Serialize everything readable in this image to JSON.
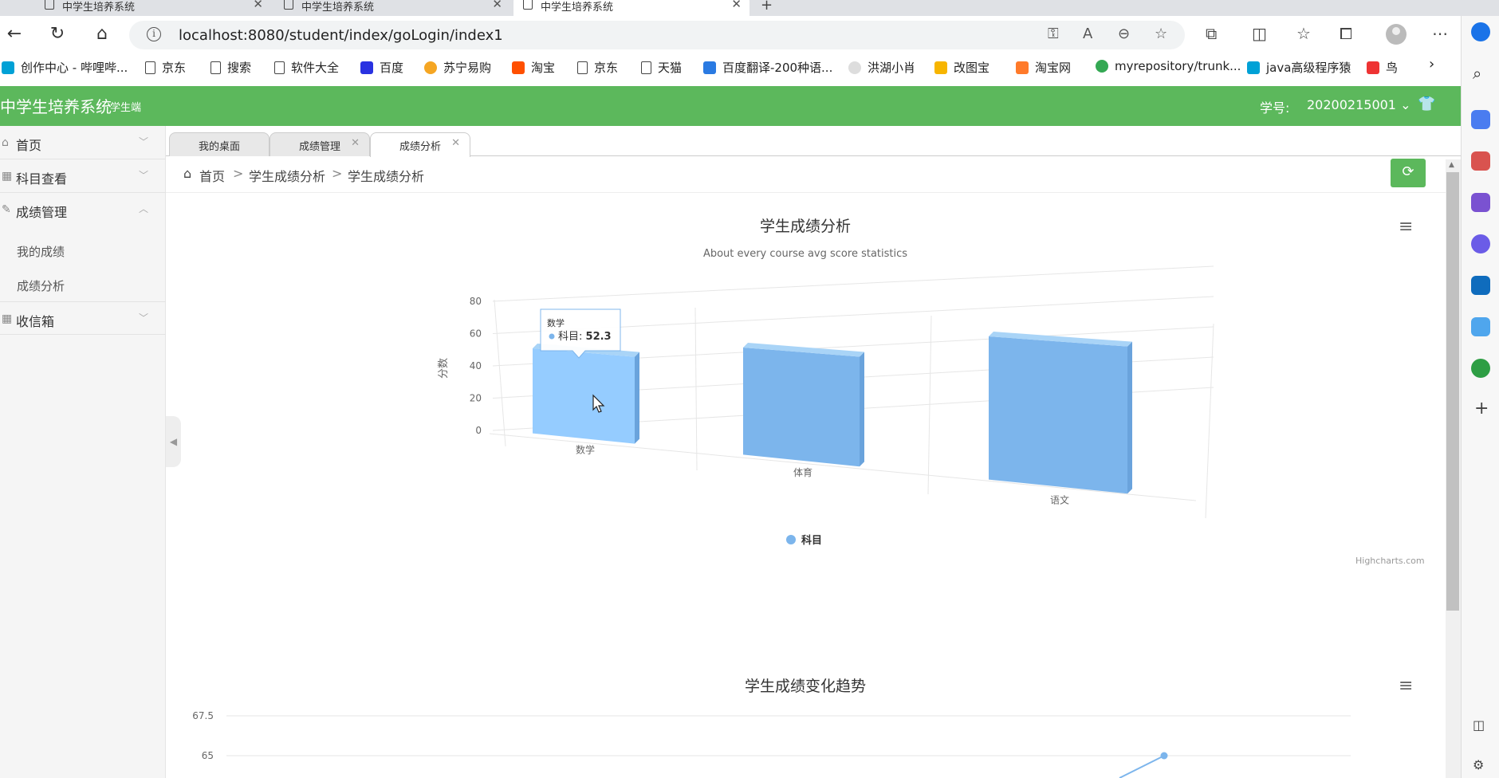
{
  "browser": {
    "tabs": [
      {
        "label": "中学生培养系统",
        "active": false
      },
      {
        "label": "中学生培养系统",
        "active": false
      },
      {
        "label": "中学生培养系统",
        "active": true
      }
    ],
    "url": "localhost:8080/student/index/goLogin/index1",
    "bookmarks": [
      "创作中心 - 哔哩哔...",
      "京东",
      "搜索",
      "软件大全",
      "百度",
      "苏宁易购",
      "淘宝",
      "京东",
      "天猫",
      "百度翻译-200种语...",
      "洪湖小肖",
      "改图宝",
      "淘宝网",
      "myrepository/trunk...",
      "java高级程序猿",
      "鸟"
    ]
  },
  "header": {
    "title": "中学生培养系统",
    "subtitle": "学生端",
    "student_label": "学号:",
    "student_id": "20200215001"
  },
  "sidebar": {
    "items": [
      {
        "label": "首页"
      },
      {
        "label": "科目查看"
      },
      {
        "label": "成绩管理"
      },
      {
        "label": "收信箱"
      }
    ],
    "subitems": [
      "我的成绩",
      "成绩分析"
    ]
  },
  "content_tabs": [
    {
      "label": "我的桌面",
      "closable": false
    },
    {
      "label": "成绩管理",
      "closable": true
    },
    {
      "label": "成绩分析",
      "closable": true,
      "active": true
    }
  ],
  "breadcrumb": [
    "首页",
    "学生成绩分析",
    "学生成绩分析"
  ],
  "breadcrumb_sep": ">",
  "chart_data": [
    {
      "type": "bar",
      "title": "学生成绩分析",
      "subtitle": "About every course avg score statistics",
      "ylabel": "分数",
      "ylim": [
        0,
        80
      ],
      "yticks": [
        0,
        20,
        40,
        60,
        80
      ],
      "categories": [
        "数学",
        "体育",
        "语文"
      ],
      "series": [
        {
          "name": "科目",
          "values": [
            52.3,
            63,
            80
          ],
          "color": "#7cb5ec"
        }
      ],
      "tooltip": {
        "category": "数学",
        "series": "科目",
        "value": "52.3"
      },
      "legend": "bottom-center",
      "credit": "Highcharts.com"
    },
    {
      "type": "line",
      "title": "学生成绩变化趋势",
      "yticks_visible": [
        "67.5",
        "65"
      ],
      "visible_point_y": 65
    }
  ]
}
